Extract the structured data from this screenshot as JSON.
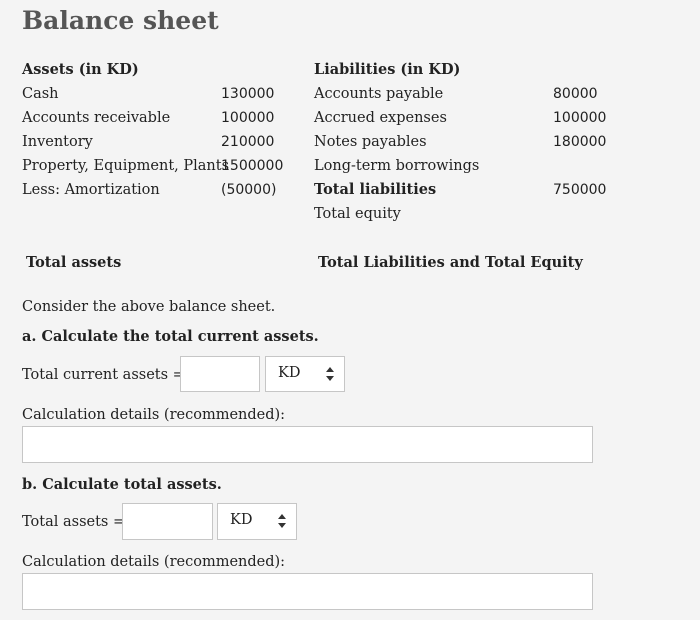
{
  "title": "Balance sheet",
  "assets": {
    "header": "Assets (in KD)",
    "rows": [
      {
        "label": "Cash",
        "value": "130000"
      },
      {
        "label": "Accounts receivable",
        "value": "100000"
      },
      {
        "label": "Inventory",
        "value": "210000"
      },
      {
        "label": "Property, Equipment, Plants",
        "value": "1500000"
      },
      {
        "label": "Less: Amortization",
        "value": "(50000)"
      }
    ],
    "total_label": "Total assets"
  },
  "liabilities": {
    "header": "Liabilities (in KD)",
    "rows": [
      {
        "label": "Accounts payable",
        "value": "80000"
      },
      {
        "label": "Accrued expenses",
        "value": "100000"
      },
      {
        "label": "Notes payables",
        "value": "180000"
      },
      {
        "label": "Long-term borrowings",
        "value": ""
      },
      {
        "label": "Total liabilities",
        "value": "750000"
      },
      {
        "label": "Total equity",
        "value": ""
      }
    ],
    "total_label": "Total Liabilities and Total Equity"
  },
  "question": {
    "intro": "Consider the above balance sheet.",
    "part_a": {
      "prompt": "a. Calculate the total current assets.",
      "input_label": "Total current assets =",
      "input_value": "",
      "unit": "KD",
      "details_label": "Calculation details (recommended):",
      "details_value": ""
    },
    "part_b": {
      "prompt": "b. Calculate total assets.",
      "input_label": "Total assets =",
      "input_value": "",
      "unit": "KD",
      "details_label": "Calculation details (recommended):",
      "details_value": ""
    }
  },
  "icons": {
    "select_arrows": "updown-arrows-icon"
  }
}
